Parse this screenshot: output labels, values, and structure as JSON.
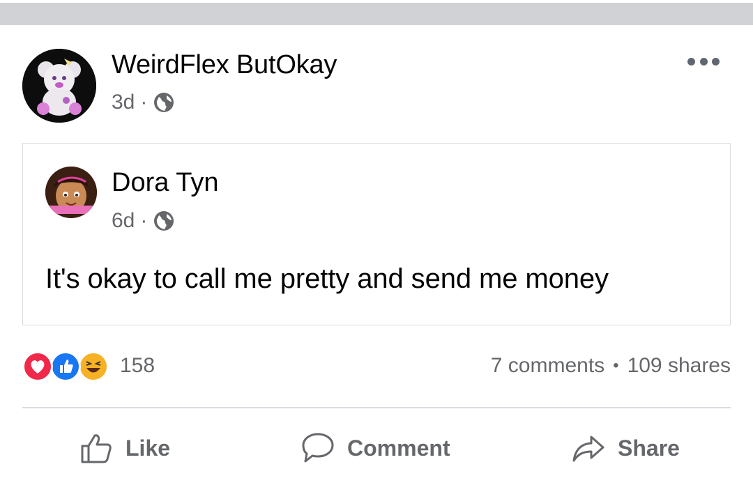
{
  "post": {
    "author": "WeirdFlex ButOkay",
    "time": "3d",
    "separator": "·",
    "privacy_icon": "globe-icon",
    "more_icon": "more-horizontal-icon"
  },
  "shared_post": {
    "author": "Dora Tyn",
    "time": "6d",
    "separator": "·",
    "privacy_icon": "globe-icon",
    "text": "It's okay to call me pretty and send me money"
  },
  "engagement": {
    "reactions": [
      "love",
      "like",
      "haha"
    ],
    "reaction_count": "158",
    "comments": "7 comments",
    "bullet": "•",
    "shares": "109 shares"
  },
  "actions": {
    "like_label": "Like",
    "comment_label": "Comment",
    "share_label": "Share"
  },
  "colors": {
    "secondary_text": "#65676b",
    "love": "#f0284a",
    "like": "#1877f2",
    "haha": "#f7b125",
    "divider": "#dadde1"
  }
}
